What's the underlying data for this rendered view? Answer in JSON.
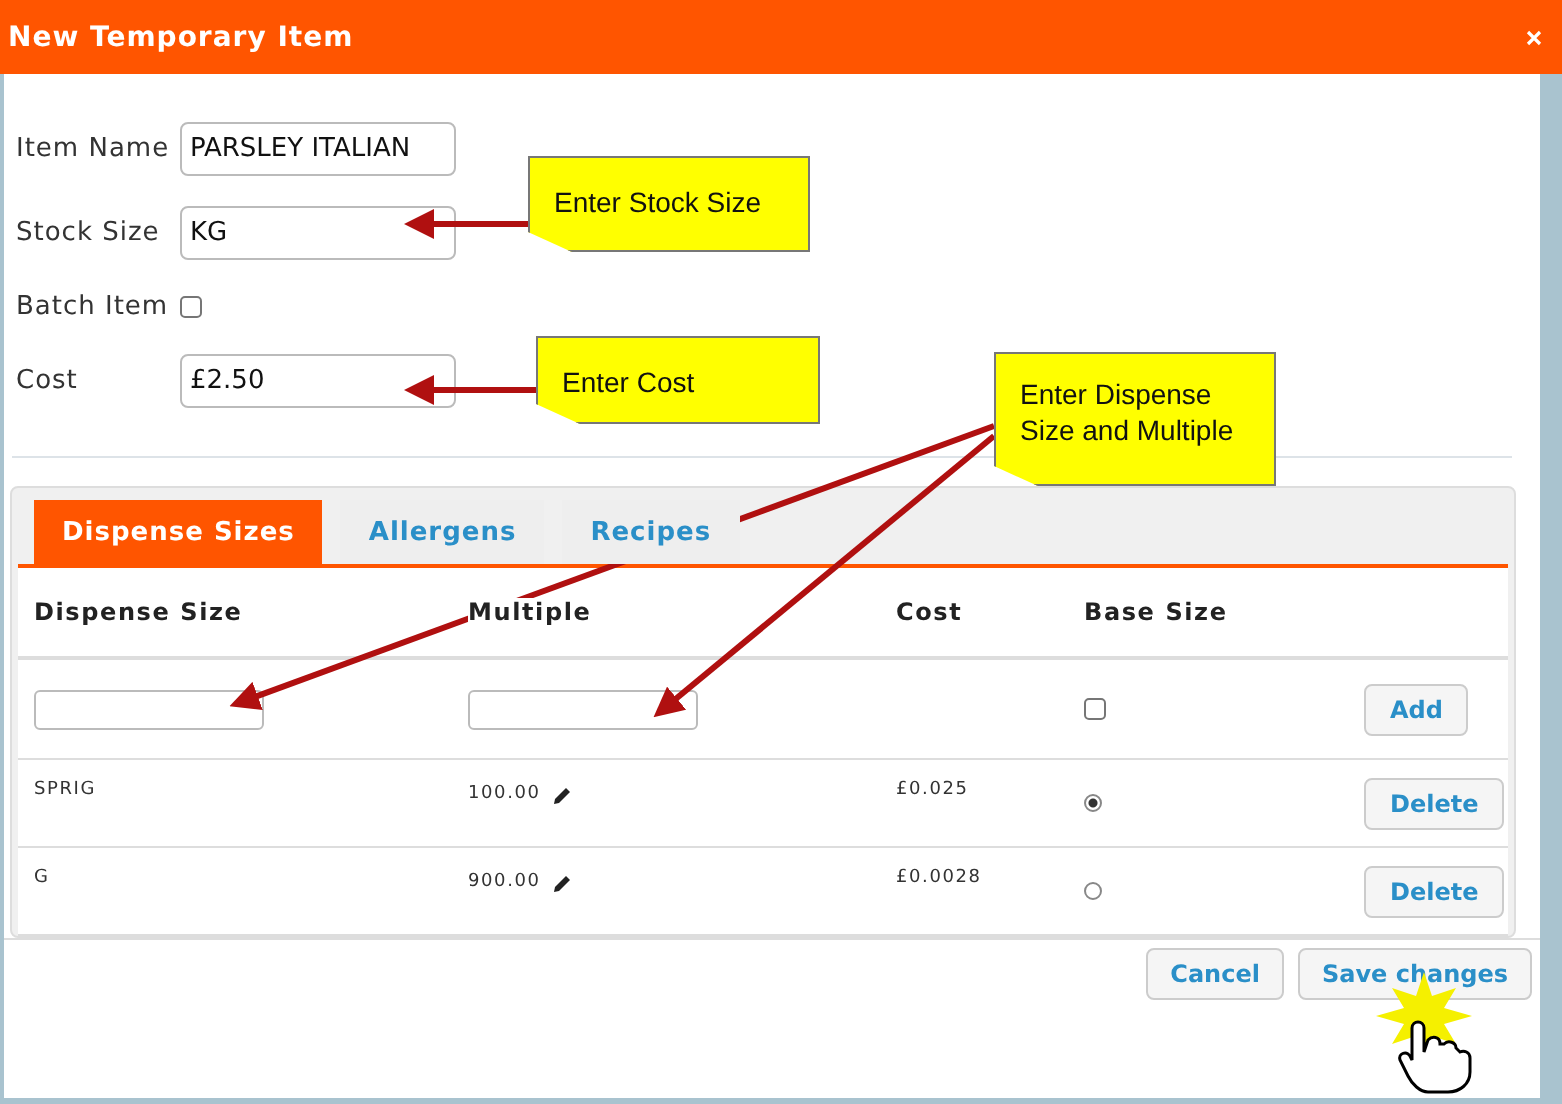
{
  "window": {
    "title": "New Temporary Item"
  },
  "fields": [
    {
      "kind": "text",
      "label": "Item Name",
      "value": "PARSLEY ITALIAN"
    },
    {
      "kind": "text",
      "label": "Stock Size",
      "value": "KG"
    },
    {
      "kind": "checkbox",
      "label": "Batch Item",
      "checked": false
    },
    {
      "kind": "text",
      "label": "Cost",
      "value": "£2.50"
    }
  ],
  "tabs": [
    {
      "label": "Dispense Sizes",
      "selected": true
    },
    {
      "label": "Allergens",
      "selected": false
    },
    {
      "label": "Recipes",
      "selected": false
    }
  ],
  "table": {
    "columns": [
      "Dispense Size",
      "Multiple",
      "Cost",
      "Base Size"
    ],
    "new_row": {
      "base_checked": false,
      "button": "Add"
    },
    "rows": [
      {
        "size": "SPRIG",
        "multiple": "100.00",
        "cost": "£0.025",
        "selected": true,
        "button": "Delete"
      },
      {
        "size": "G",
        "multiple": "900.00",
        "cost": "£0.0028",
        "selected": false,
        "button": "Delete"
      }
    ]
  },
  "buttons": [
    "Cancel",
    "Save changes"
  ],
  "callouts": [
    "Enter Stock Size",
    "Enter Cost",
    "Enter Dispense Size and Multiple"
  ]
}
